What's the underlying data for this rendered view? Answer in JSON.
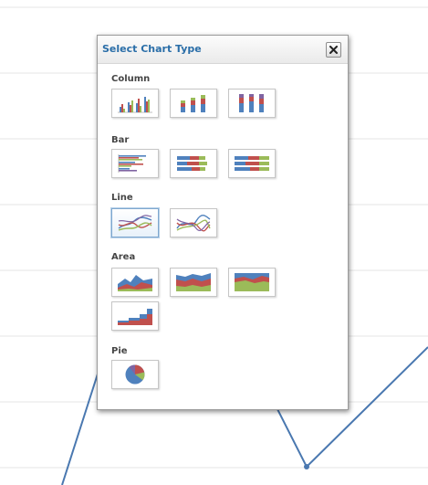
{
  "dialog": {
    "title": "Select Chart Type",
    "close_icon": "close-x-icon"
  },
  "sections": [
    {
      "label": "Column",
      "options": [
        "clustered-column-icon",
        "stacked-column-icon",
        "100-percent-stacked-column-icon"
      ]
    },
    {
      "label": "Bar",
      "options": [
        "clustered-bar-icon",
        "stacked-bar-icon",
        "100-percent-stacked-bar-icon"
      ]
    },
    {
      "label": "Line",
      "options": [
        "line-chart-icon",
        "line-with-markers-icon"
      ],
      "selected_option": "line-chart-icon"
    },
    {
      "label": "Area",
      "options": [
        "area-chart-icon",
        "stacked-area-icon",
        "100-percent-stacked-area-icon",
        "step-area-icon"
      ]
    },
    {
      "label": "Pie",
      "options": [
        "pie-chart-icon"
      ]
    }
  ],
  "colors": {
    "title": "#2a6ea8",
    "series_blue": "#4f81bd",
    "series_red": "#c0504d",
    "series_green": "#9bbb59",
    "series_purple": "#8064a2",
    "background_line": "#4a78b0",
    "gridline": "#e4e4e4"
  }
}
